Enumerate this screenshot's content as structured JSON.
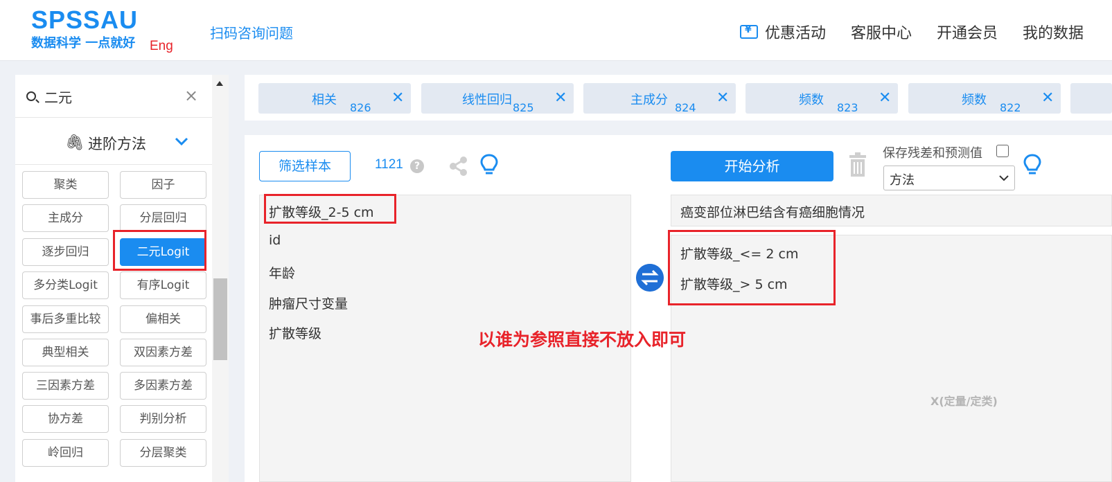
{
  "header": {
    "logo": "SPSSAU",
    "slogan": "数据科学 一点就好",
    "lang": "Eng",
    "scan_link": "扫码咨询问题",
    "nav": [
      "优惠活动",
      "客服中心",
      "开通会员",
      "我的数据"
    ]
  },
  "sidebar": {
    "search_value": "二元",
    "section_title": "进阶方法",
    "methods": [
      "聚类",
      "因子",
      "主成分",
      "分层回归",
      "逐步回归",
      "二元Logit",
      "多分类Logit",
      "有序Logit",
      "事后多重比较",
      "偏相关",
      "典型相关",
      "双因素方差",
      "三因素方差",
      "多因素方差",
      "协方差",
      "判别分析",
      "岭回归",
      "分层聚类"
    ],
    "active_method": "二元Logit"
  },
  "tabs": [
    {
      "label": "相关",
      "num": "826"
    },
    {
      "label": "线性回归",
      "num": "825"
    },
    {
      "label": "主成分",
      "num": "824"
    },
    {
      "label": "频数",
      "num": "823"
    },
    {
      "label": "频数",
      "num": "822"
    }
  ],
  "toolbar": {
    "filter_label": "筛选样本",
    "sample_count": "1121",
    "start_label": "开始分析",
    "save_label": "保存残差和预测值",
    "method_select": "方法"
  },
  "variables": [
    "扩散等级_2-5 cm",
    "id",
    "年龄",
    "肿瘤尺寸变量",
    "扩散等级"
  ],
  "dependent": "癌变部位淋巴结含有癌细胞情况",
  "x_variables": [
    "扩散等级_<= 2 cm",
    "扩散等级_> 5 cm"
  ],
  "x_placeholder": "X(定量/定类)",
  "annotation": "以谁为参照直接不放入即可",
  "colors": {
    "accent": "#1a8cf0",
    "annotation": "#e8232a"
  }
}
